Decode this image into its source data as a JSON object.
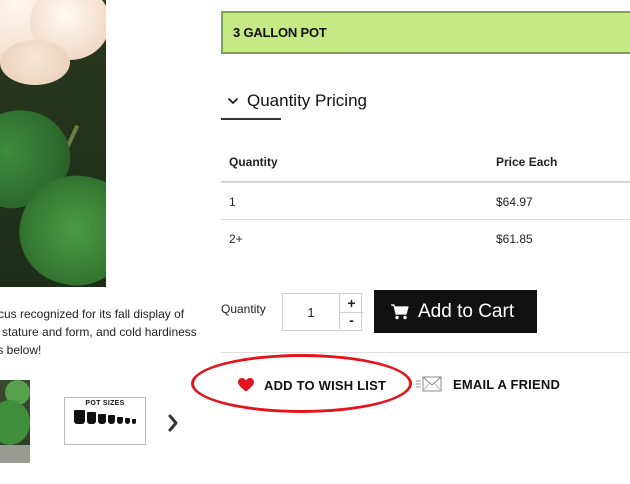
{
  "product": {
    "description_lines": [
      "scus recognized for its fall display of",
      "e stature and form, and cold hardiness",
      "ils below!"
    ],
    "thumbnails": {
      "pot_sizes_title": "POT SIZES"
    }
  },
  "size": {
    "selected": "3 GALLON POT"
  },
  "quantity_pricing": {
    "title": "Quantity Pricing",
    "headers": [
      "Quantity",
      "Price Each"
    ],
    "rows": [
      {
        "quantity": "1",
        "price": "$64.97"
      },
      {
        "quantity": "2+",
        "price": "$61.85"
      }
    ]
  },
  "purchase": {
    "quantity_label": "Quantity",
    "quantity_value": "1",
    "increment": "+",
    "decrement": "-",
    "add_to_cart": "Add to Cart"
  },
  "actions": {
    "wish_list": "ADD TO WISH LIST",
    "email_friend": "EMAIL A FRIEND"
  },
  "colors": {
    "size_box_bg": "#c5ea83",
    "highlight_ellipse": "#e3151c",
    "heart": "#e3151c",
    "cart_button": "#111111"
  },
  "icons": {
    "chevron": "chevron-down-icon",
    "cart": "cart-icon",
    "heart": "heart-icon",
    "envelope": "envelope-icon",
    "next": "chevron-right-icon"
  }
}
